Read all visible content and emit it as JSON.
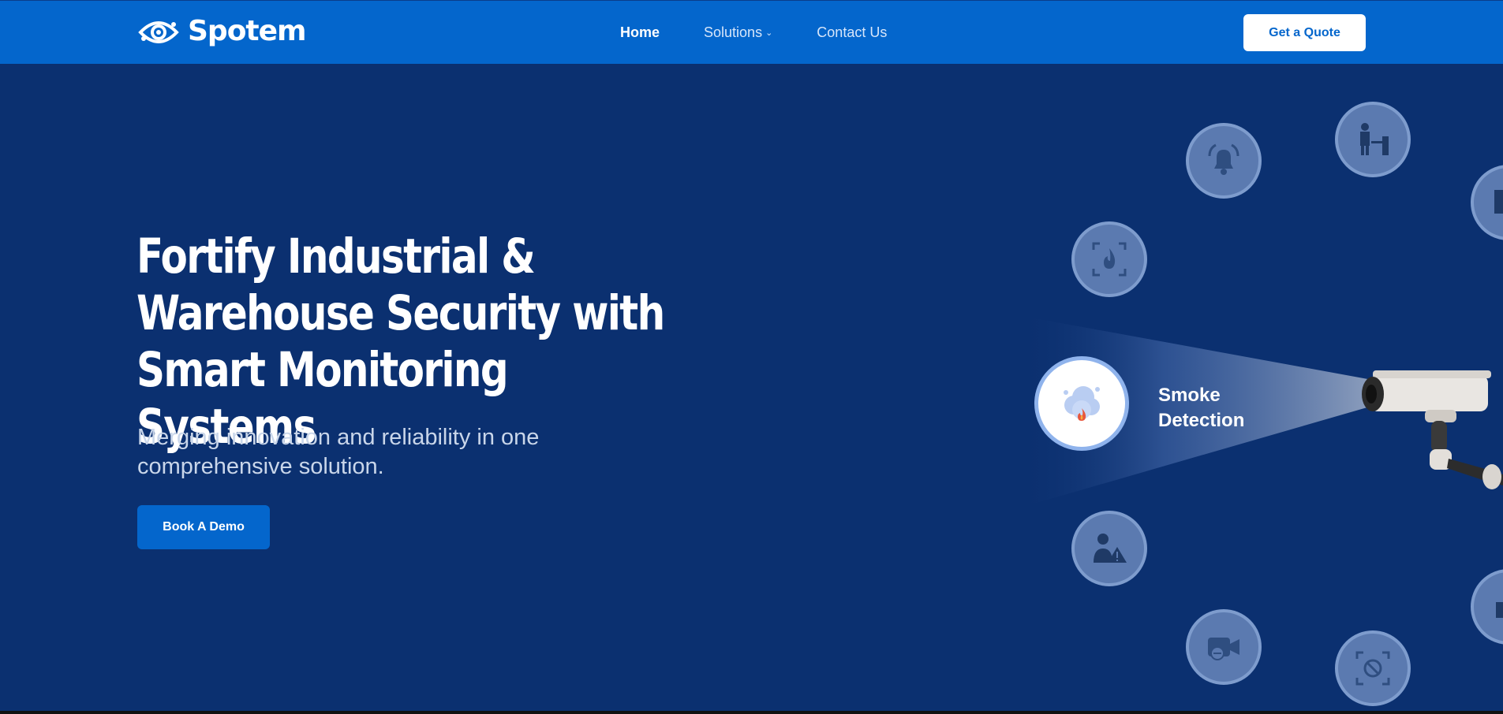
{
  "brand": {
    "name": "Spotem",
    "logo_icon": "eye-logo-icon"
  },
  "nav": {
    "links": [
      {
        "label": "Home",
        "active": true
      },
      {
        "label": "Solutions",
        "dropdown": true
      },
      {
        "label": "Contact Us"
      }
    ],
    "cta_label": "Get a Quote"
  },
  "hero": {
    "title_lines": [
      "Fortify Industrial &",
      "Warehouse Security with",
      "Smart Monitoring Systems"
    ],
    "subtitle": "Merging innovation and reliability in one comprehensive solution.",
    "cta_label": "Book A Demo"
  },
  "illustration": {
    "active_feature": {
      "label_line1": "Smoke",
      "label_line2": "Detection",
      "icon": "smoke-fire-icon"
    },
    "feature_icons": [
      "alarm-bell-icon",
      "security-guard-gate-icon",
      "fire-detection-icon",
      "person-warning-icon",
      "camera-offline-icon",
      "blocked-view-icon"
    ]
  },
  "colors": {
    "nav_bg": "#0466cc",
    "hero_bg": "#0b3070",
    "accent": "#0466cc",
    "circle_bg": "#5b7ab0"
  }
}
